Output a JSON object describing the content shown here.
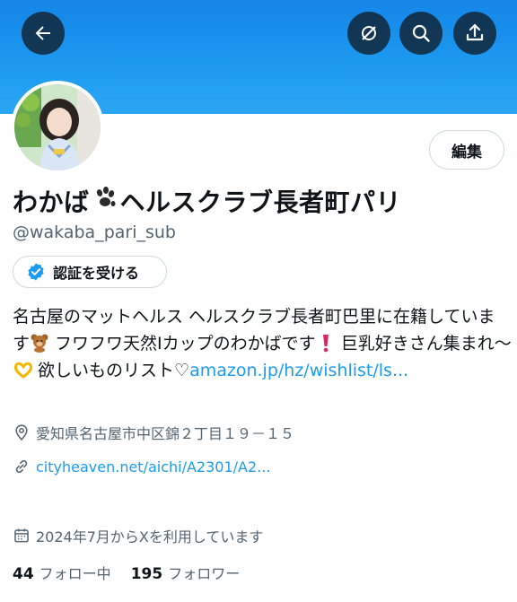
{
  "header": {
    "back_icon": "arrow-left-icon",
    "grok_icon": "slash-circle-icon",
    "search_icon": "search-icon",
    "share_icon": "share-upload-icon",
    "banner_color": "#1d9bf0"
  },
  "profile": {
    "edit_label": "編集",
    "name_part1": "わかば",
    "name_part2": "ヘルスクラブ長者町パリ",
    "handle": "@wakaba_pari_sub",
    "verify_label": "認証を受ける",
    "bio_text1": "名古屋のマットヘルス ヘルスクラブ長者町巴里に在籍しています",
    "bio_text2": " フワフワ天然Iカップのわかばです",
    "bio_text3": " 巨乳好きさん集まれ～",
    "bio_text4": " 欲しいものリスト♡",
    "bio_link": "amazon.jp/hz/wishlist/ls...",
    "location": "愛知県名古屋市中区錦２丁目１９－１５",
    "website": "cityheaven.net/aichi/A2301/A2...",
    "joined": "2024年7月からXを利用しています",
    "following_count": "44",
    "following_label": "フォロー中",
    "followers_count": "195",
    "followers_label": "フォロワー"
  },
  "colors": {
    "link": "#1d9bf0",
    "secondary_text": "#536471",
    "verified_badge": "#1d9bf0"
  }
}
